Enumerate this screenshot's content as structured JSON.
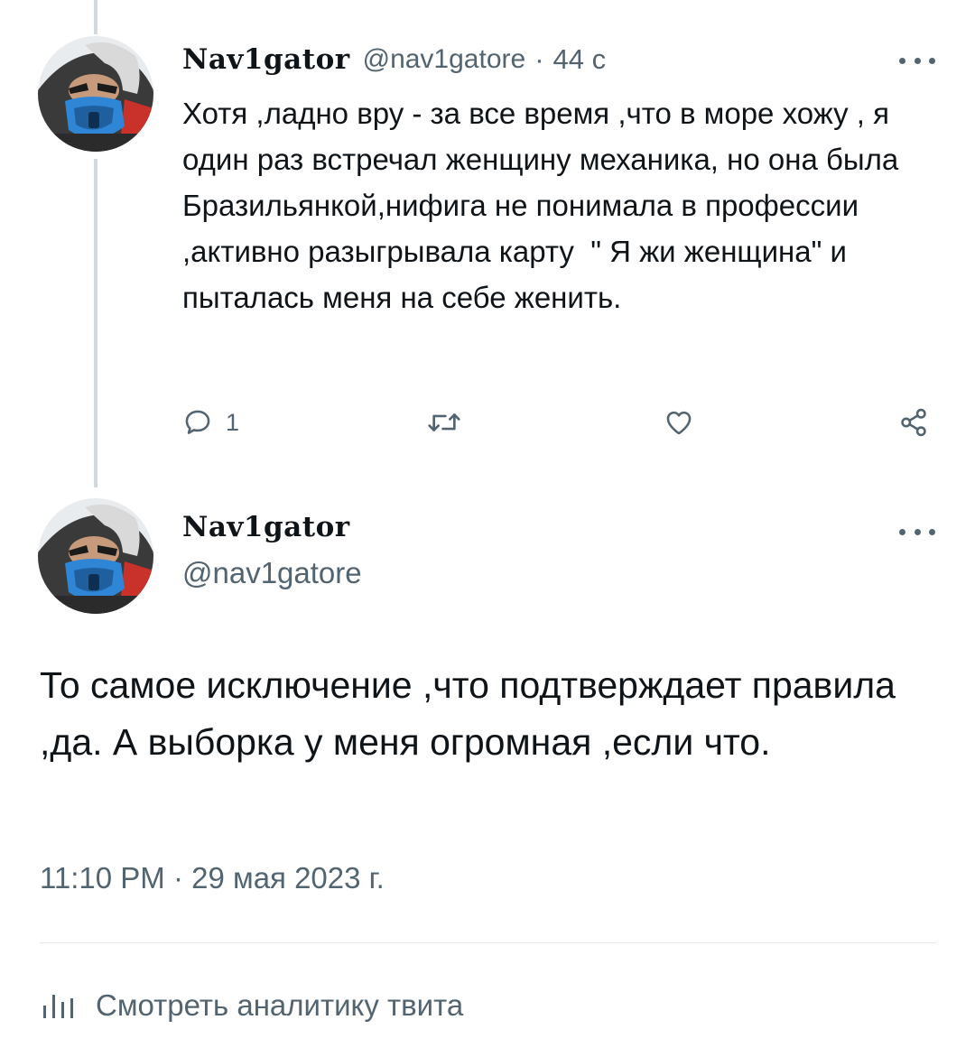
{
  "reply_tweet": {
    "display_name": "Nav1gator",
    "handle": "@nav1gatore",
    "separator": "·",
    "time_ago": "44 с",
    "text": "Хотя ,ладно вру - за все время ,что в море хожу , я один раз встречал женщину механика, но она была Бразильянкой,нифига не понимала в профессии ,активно разыгрывала карту  \" Я жи женщина\" и пыталась меня на себе женить.",
    "actions": {
      "reply_icon": "speech-bubble-icon",
      "reply_count": "1",
      "retweet_icon": "retweet-icon",
      "like_icon": "heart-icon",
      "share_icon": "share-nodes-icon"
    }
  },
  "main_tweet": {
    "display_name": "Nav1gator",
    "handle": "@nav1gatore",
    "text": "То самое исключение ,что подтверждает правила ,да. А выборка у меня огромная ,если что.",
    "timestamp": "11:10 PM · 29 мая 2023 г."
  },
  "analytics": {
    "icon": "bar-chart-icon",
    "label": "Смотреть аналитику твита"
  },
  "colors": {
    "text": "#0f1419",
    "muted": "#536471",
    "thread_line": "#cfd9de",
    "divider": "#e4e9ec",
    "mask_blue": "#2f86d6"
  }
}
